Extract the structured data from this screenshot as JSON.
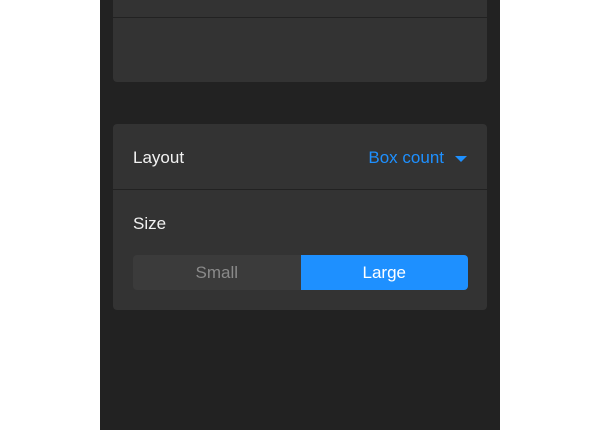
{
  "layout_setting": {
    "label": "Layout",
    "value": "Box count"
  },
  "size_setting": {
    "label": "Size",
    "options": [
      "Small",
      "Large"
    ],
    "selected": "Large"
  },
  "colors": {
    "accent": "#1e90ff",
    "panel_bg": "#222222",
    "card_bg": "#333333"
  }
}
